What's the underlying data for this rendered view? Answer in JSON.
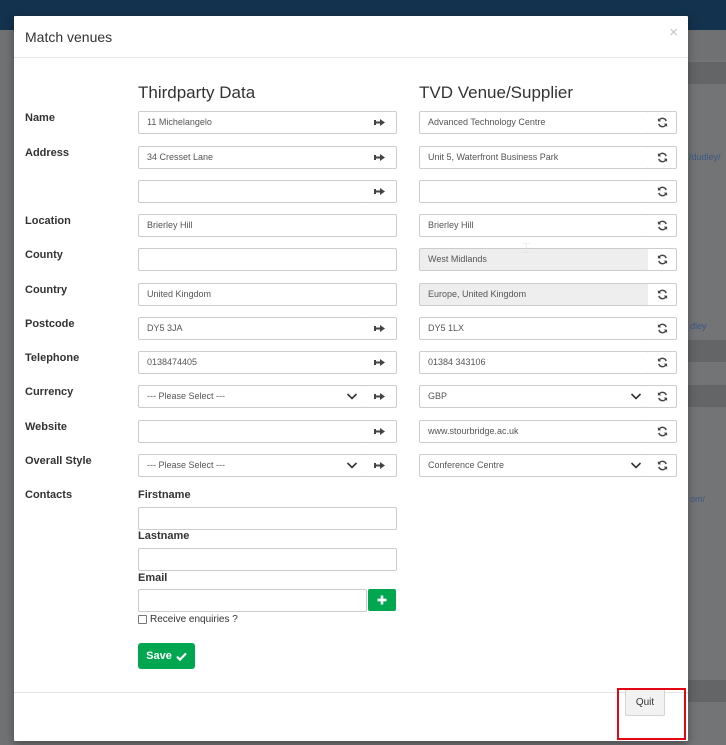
{
  "modal": {
    "title": "Match venues",
    "close_symbol": "×",
    "left_heading": "Thirdparty Data",
    "right_heading": "TVD Venue/Supplier"
  },
  "rows": {
    "name": {
      "label": "Name",
      "left": "11 Michelangelo",
      "right": "Advanced Technology Centre"
    },
    "address": {
      "label": "Address",
      "left": "34 Cresset Lane",
      "right": "Unit 5, Waterfront Business Park"
    },
    "address2": {
      "left": "",
      "right": ""
    },
    "location": {
      "label": "Location",
      "left": "Brierley Hill",
      "right": "Brierley Hill"
    },
    "county": {
      "label": "County",
      "left": "",
      "right": "West Midlands"
    },
    "country": {
      "label": "Country",
      "left": "United Kingdom",
      "right": "Europe, United Kingdom"
    },
    "postcode": {
      "label": "Postcode",
      "left": "DY5 3JA",
      "right": "DY5 1LX"
    },
    "telephone": {
      "label": "Telephone",
      "left": "0138474405",
      "right": "01384 343106"
    },
    "currency": {
      "label": "Currency",
      "left": "--- Please Select ---",
      "right": "GBP"
    },
    "website": {
      "label": "Website",
      "left": "",
      "right": "www.stourbridge.ac.uk"
    },
    "overall_style": {
      "label": "Overall Style",
      "left": "--- Please Select ---",
      "right": "Conference Centre"
    }
  },
  "contacts": {
    "label": "Contacts",
    "firstname_label": "Firstname",
    "lastname_label": "Lastname",
    "email_label": "Email",
    "firstname_value": "",
    "lastname_value": "",
    "email_value": "",
    "receive_enquiries_label": "Receive enquiries ?",
    "receive_enquiries_checked": false
  },
  "buttons": {
    "save_label": "Save",
    "quit_label": "Quit"
  },
  "background_links": {
    "link1": "/dudley/",
    "link2": "dley",
    "link3": "om/"
  },
  "icons": {
    "copy_arrow": "arrow-right-icon",
    "refresh": "refresh-icon",
    "chevron": "chevron-down-icon",
    "plus": "plus-icon",
    "check": "check-icon"
  },
  "colors": {
    "header_bar": "#13324d",
    "save_green": "#00a650",
    "highlight_red": "#e30613"
  }
}
